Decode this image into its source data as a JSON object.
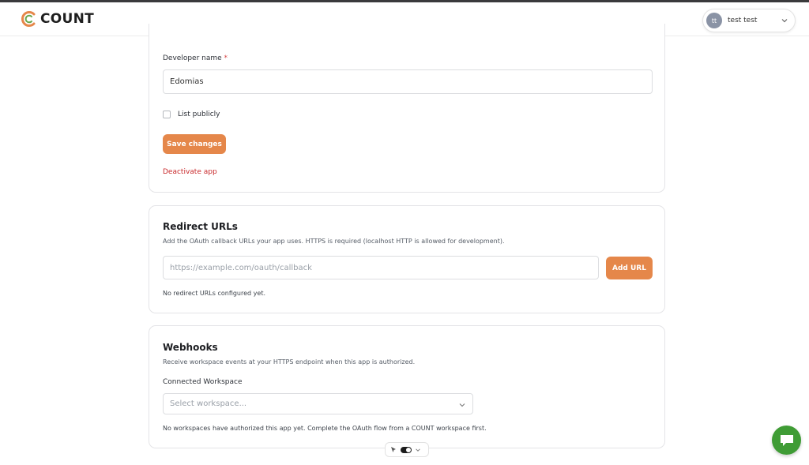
{
  "app": {
    "logo_text": "COUNT"
  },
  "user_menu": {
    "initials": "tt",
    "name": "test test"
  },
  "developer": {
    "name_label": "Developer name",
    "required_mark": "*",
    "name_value": "Edomias",
    "list_publicly_label": "List publicly",
    "list_publicly_checked": false,
    "save_label": "Save changes",
    "deactivate_label": "Deactivate app"
  },
  "redirects": {
    "title": "Redirect URLs",
    "description": "Add the OAuth callback URLs your app uses. HTTPS is required (localhost HTTP is allowed for development).",
    "placeholder": "https://example.com/oauth/callback",
    "add_label": "Add URL",
    "empty_note": "No redirect URLs configured yet."
  },
  "webhooks": {
    "title": "Webhooks",
    "description": "Receive workspace events at your HTTPS endpoint when this app is authorized.",
    "workspace_label": "Connected Workspace",
    "workspace_placeholder": "Select workspace...",
    "empty_note": "No workspaces have authorized this app yet. Complete the OAuth flow from a COUNT workspace first."
  },
  "colors": {
    "accent": "#e5874a",
    "danger": "#c8282a",
    "chat": "#3f9c35"
  }
}
